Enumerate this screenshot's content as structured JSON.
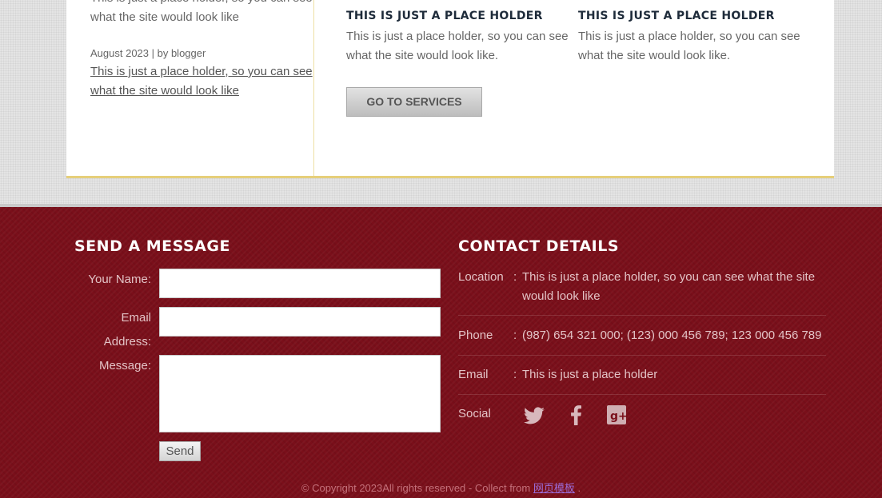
{
  "blog": {
    "prev_text": "This is just a place holder, so you can see what the site would look like",
    "meta": "August 2023 | by blogger",
    "excerpt": "This is just a place holder, so you can see what the site would look like"
  },
  "services": [
    {
      "title": "THIS IS JUST A PLACE HOLDER",
      "text": "This is just a place holder, so you can see what the site would look like."
    },
    {
      "title": "THIS IS JUST A PLACE HOLDER",
      "text": "This is just a place holder, so you can see what the site would look like."
    }
  ],
  "go_services_label": "GO TO SERVICES",
  "message_form": {
    "title": "SEND A MESSAGE",
    "name_label": "Your Name:",
    "email_label": "Email Address:",
    "message_label": "Message:",
    "name_value": "",
    "email_value": "",
    "message_value": "",
    "send_label": "Send"
  },
  "contact": {
    "title": "CONTACT DETAILS",
    "location_label": "Location",
    "location_value": "This is just a place holder, so you can see what the site would look like",
    "phone_label": "Phone",
    "phone_value": "(987) 654 321 000; (123) 000 456 789; 123 000 456 789",
    "email_label": "Email",
    "email_value": "This is just a place holder",
    "social_label": "Social",
    "colon": ":",
    "social_icons": [
      "twitter-icon",
      "facebook-icon",
      "google-plus-icon"
    ]
  },
  "footer": {
    "copyright": "© Copyright 2023All rights reserved - Collect from",
    "link_text": "网页模板",
    "suffix": "."
  },
  "colors": {
    "footer_bg": "#7a0f1a",
    "accent_line": "#e6cf7a",
    "heading_dark": "#1e2b3a"
  }
}
